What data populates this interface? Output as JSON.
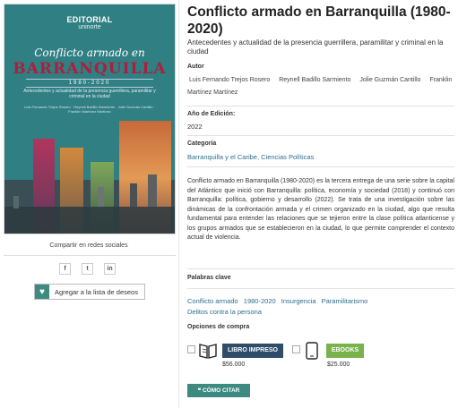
{
  "cover": {
    "publisher": "EDITORIAL",
    "publisher_sub": "uninorte",
    "title_line1": "Conflicto armado en",
    "title_line2": "BARRANQUILLA",
    "years": "1980-2020",
    "subtitle": "Antecedentes y actualidad de la presencia guerrillera, paramilitar y criminal en la ciudad",
    "authors": "Luis Fernando Trejos Rosero · Reynell Badillo Sarmiento · Jolie Guzmán Cantillo · Franklin Martínez Martínez"
  },
  "share": {
    "title": "Compartir en redes sociales",
    "facebook": "f",
    "twitter": "t",
    "linkedin": "in"
  },
  "wishlist": {
    "label": "Agregar a la lista de deseos"
  },
  "book": {
    "title": "Conflicto armado en Barranquilla (1980-2020)",
    "subtitle": "Antecedentes y actualidad de la presencia guerrillera, paramilitar y criminal en la ciudad",
    "author_label": "Autor",
    "authors": [
      "Luis Fernando Trejos Rosero",
      "Reynell Badillo Sarmiento",
      "Jolie Guzmán Cantillo",
      "Franklin Martínez Martínez"
    ],
    "edition_label": "Año de Edición:",
    "edition_year": "2022",
    "category_label": "Categoría",
    "category": "Barranquilla y el Caribe, Ciencias Políticas",
    "description": "Conflicto armado en Barranquilla (1980-2020) es la tercera entrega de una serie sobre la capital del Atlántico que inició con Barranquilla: política, economía y sociedad (2018) y continuó con Barranquilla: política, gobierno y desarrollo (2022). Se trata de una investigación sobre las dinámicas de la confrontación armada y el crimen organizado en la ciudad, algo que resulta fundamental para entender las relaciones que se tejieron entre la clase política atlanticense y los grupos armados que se establecieron en la ciudad, lo que permite comprender el contexto actual de violencia.",
    "keywords_label": "Palabras clave",
    "keywords": [
      "Conflicto armado",
      "1980-2020",
      "Insurgencia",
      "Paramilitarismo",
      "Delitos contra la persona"
    ],
    "purchase_label": "Opciones de compra",
    "print_label": "LIBRO IMPRESO",
    "print_price": "$56.000",
    "ebook_label": "EBOOKS",
    "ebook_price": "$25.000",
    "cite_label": "CÓMO CITAR"
  },
  "colors": {
    "accent": "#3d8a80",
    "link": "#2b6e8c",
    "print_button": "#2d4d6b",
    "ebook_button": "#7ab34c",
    "cover_bg": "#2f7f83",
    "cover_title": "#ad1f3c"
  }
}
